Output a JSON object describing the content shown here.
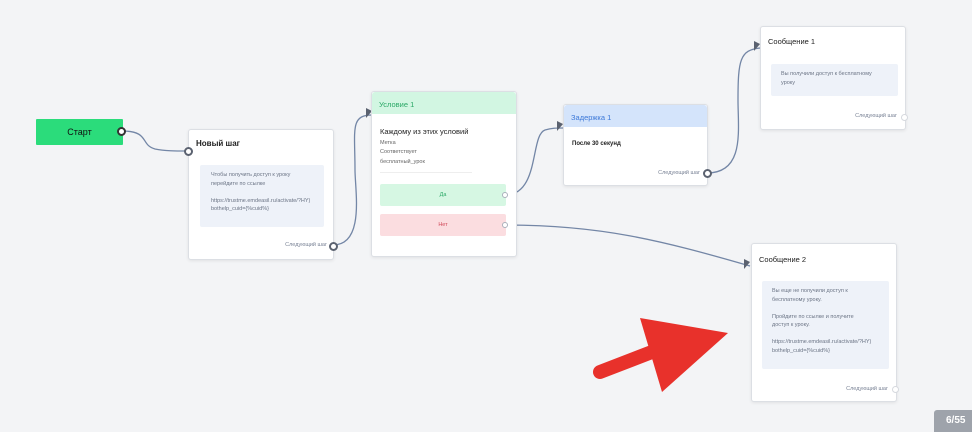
{
  "start": {
    "label": "Старт"
  },
  "step1": {
    "title": "Новый шаг",
    "message": "Чтобы получить доступ к уроку\nперейдите по ссылке\n\nhttps://trustme.emdeasil.ru/activate/?HY)\nbothelp_cuid={%cuid%}",
    "next_label": "Следующий шаг"
  },
  "condition": {
    "header": "Условие 1",
    "title": "Каждому из этих условий",
    "lines": [
      "Метка",
      "Соответствует",
      "бесплатный_урок"
    ],
    "yes_label": "Да",
    "no_label": "Нет"
  },
  "delay": {
    "header": "Задержка 1",
    "text": "После 30 секунд",
    "next_label": "Следующий шаг"
  },
  "message1": {
    "title": "Сообщение 1",
    "message": "Вы получили доступ к бесплатному\nуроку",
    "next_label": "Следующий шаг"
  },
  "message2": {
    "title": "Сообщение 2",
    "message": "Вы еще не получили доступ к\nбесплатному уроку.\n\nПройдите по ссылке и получите\nдоступ к уроку.\n\nhttps://trustme.emdeasil.ru/activate/?HY)\nbothelp_cuid={%cuid%}",
    "next_label": "Следующий шаг"
  },
  "pager": {
    "text": "6/55"
  },
  "colors": {
    "start": "#2bdc7b",
    "condition_header": "#d2f6e2",
    "delay_header": "#d4e4fb",
    "yes": "#d6f7e3",
    "no": "#fbdde0",
    "arrow": "#e8312b",
    "edge": "#7386a6"
  }
}
